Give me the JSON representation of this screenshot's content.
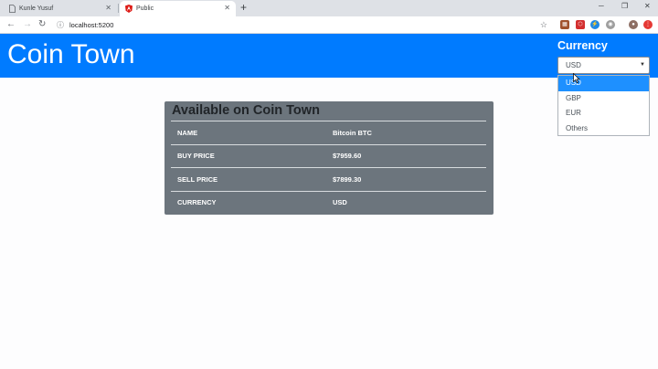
{
  "browser": {
    "tabs": [
      {
        "label": "Kunle Yusuf",
        "icon": "document-icon"
      },
      {
        "label": "Public",
        "icon": "angular-icon",
        "active": true
      }
    ],
    "address": "localhost:5200"
  },
  "app": {
    "brand": "Coin Town",
    "currency_title": "Currency",
    "selected_currency": "USD",
    "currency_options": [
      "USD",
      "GBP",
      "EUR",
      "Others"
    ],
    "accent_color": "#007bff"
  },
  "card": {
    "title": "Available on Coin Town",
    "rows": [
      {
        "key": "NAME",
        "value": "Bitcoin BTC"
      },
      {
        "key": "BUY PRICE",
        "value": "$7959.60"
      },
      {
        "key": "SELL PRICE",
        "value": "$7899.30"
      },
      {
        "key": "CURRENCY",
        "value": "USD"
      }
    ]
  }
}
